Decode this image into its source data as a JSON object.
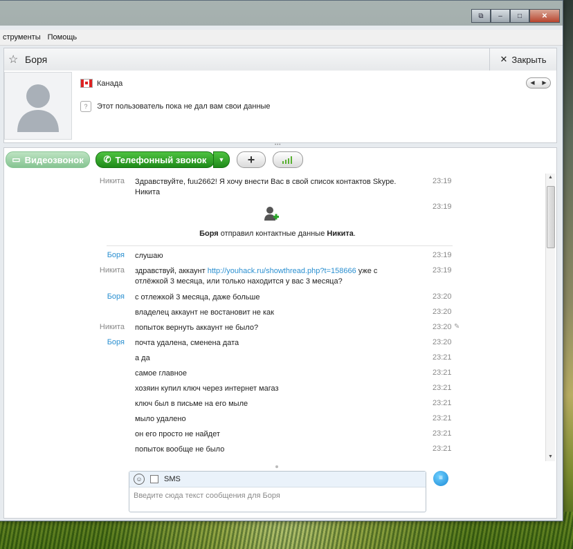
{
  "menu": [
    "струменты",
    "Помощь"
  ],
  "window_buttons": [
    "⧉",
    "–",
    "□",
    "✕"
  ],
  "contact": {
    "name": "Боря",
    "close_label": "Закрыть"
  },
  "profile": {
    "country": "Канада",
    "info": "Этот пользователь пока не дал вам свои данные",
    "nav_prev": "◀",
    "nav_next": "▶"
  },
  "toolbar": {
    "video_label": "Видеозвонок",
    "phone_label": "Телефонный звонок",
    "add_label": "+"
  },
  "messages": [
    {
      "sender": "Никита",
      "self": false,
      "text": "Здравствуйте, fuu2662! Я хочу внести Вас в свой список контактов Skype.",
      "text2": "Никита",
      "time": "23:19"
    },
    {
      "sender": "",
      "self": false,
      "text": "",
      "time": "23:19"
    }
  ],
  "system": {
    "line_name1": "Боря",
    "line_mid": " отправил контактные данные ",
    "line_name2": "Никита",
    "line_end": "."
  },
  "chat": [
    {
      "sender": "Боря",
      "self": true,
      "text": "слушаю",
      "time": "23:19"
    },
    {
      "sender": "Никита",
      "self": false,
      "text_pre": "здравствуй, аккаунт ",
      "link": "http://youhack.ru/showthread.php?t=158666",
      "text_post": " уже с",
      "text2": "отлёжкой 3 месяца, или только находится у вас 3 месяца?",
      "time": "23:19"
    },
    {
      "sender": "Боря",
      "self": true,
      "text": "с отлежкой 3 месяца, даже больше",
      "time": "23:20"
    },
    {
      "sender": "",
      "self": true,
      "text": "владелец аккаунт не востановит не как",
      "time": "23:20"
    },
    {
      "sender": "Никита",
      "self": false,
      "text": "попыток вернуть аккаунт не было?",
      "time": "23:20"
    },
    {
      "sender": "Боря",
      "self": true,
      "text": "почта удалена, сменена дата",
      "time": "23:20"
    },
    {
      "sender": "",
      "self": true,
      "text": "а да",
      "time": "23:21"
    },
    {
      "sender": "",
      "self": true,
      "text": "самое главное",
      "time": "23:21"
    },
    {
      "sender": "",
      "self": true,
      "text": "хозяин купил ключ через интернет магаз",
      "time": "23:21"
    },
    {
      "sender": "",
      "self": true,
      "text": "ключ был в письме на его мыле",
      "time": "23:21"
    },
    {
      "sender": "",
      "self": true,
      "text": "мыло удалено",
      "time": "23:21"
    },
    {
      "sender": "",
      "self": true,
      "text": "он его просто не найдет",
      "time": "23:21"
    },
    {
      "sender": "",
      "self": true,
      "text": "попыток вообще не было",
      "time": "23:21"
    }
  ],
  "input": {
    "sms_label": "SMS",
    "placeholder": "Введите сюда текст сообщения для Боря"
  },
  "colors": {
    "accent": "#2a8fd0",
    "call_green": "#1f8a1a"
  }
}
